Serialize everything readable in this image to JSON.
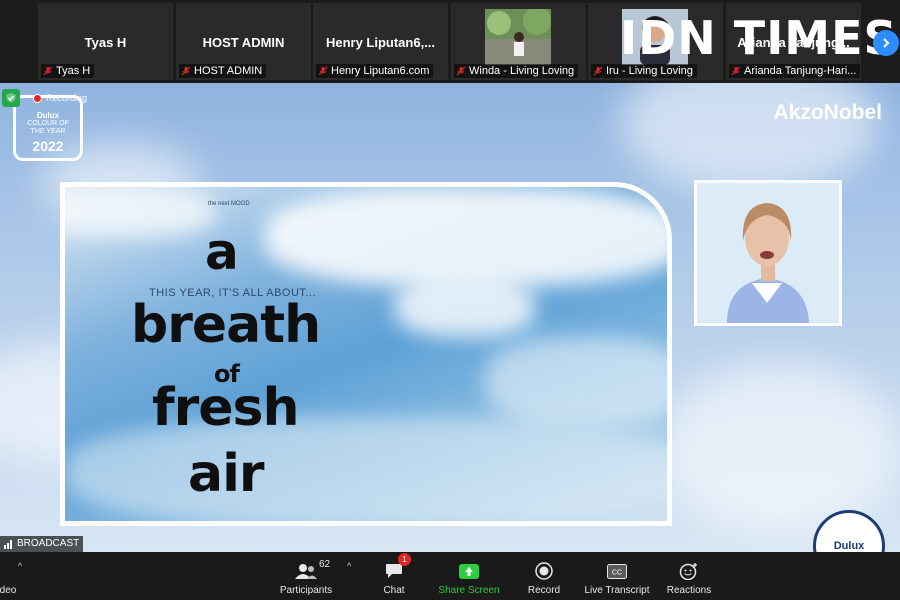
{
  "watermark": {
    "text": "IDN TIMES"
  },
  "gallery": [
    {
      "name": "Tyas H",
      "label": "Tyas H"
    },
    {
      "name": "HOST ADMIN",
      "label": "HOST ADMIN"
    },
    {
      "name": "Henry  Liputan6,...",
      "label": "Henry Liputan6.com"
    },
    {
      "name": "",
      "label": "Winda - Living Loving"
    },
    {
      "name": "",
      "label": "Iru - Living Loving"
    },
    {
      "name": "Arianda Tanjung...",
      "label": "Arianda Tanjung-Hari..."
    }
  ],
  "meeting": {
    "recording_label": "Recording",
    "broadcast_label": "BROADCAST"
  },
  "slide": {
    "badge_brand": "Dulux",
    "badge_line1": "COLOUR OF",
    "badge_line2": "THE YEAR",
    "badge_year": "2022",
    "brand": "AkzoNobel",
    "small_caption": "the next MOOD",
    "subtitle": "THIS YEAR, IT'S ALL ABOUT...",
    "words": [
      "a",
      "breath",
      "of",
      "fresh",
      "air"
    ],
    "seal_text": "Dulux"
  },
  "toolbar": {
    "video_label": "deo",
    "participants_label": "Participants",
    "participants_count": "62",
    "chat_label": "Chat",
    "chat_badge": "1",
    "share_label": "Share Screen",
    "record_label": "Record",
    "transcript_label": "Live Transcript",
    "reactions_label": "Reactions"
  },
  "colors": {
    "accent": "#2d8cff",
    "share_green": "#2ecc40",
    "recording_red": "#e02828",
    "toolbar_bg": "#1a1a1a"
  }
}
